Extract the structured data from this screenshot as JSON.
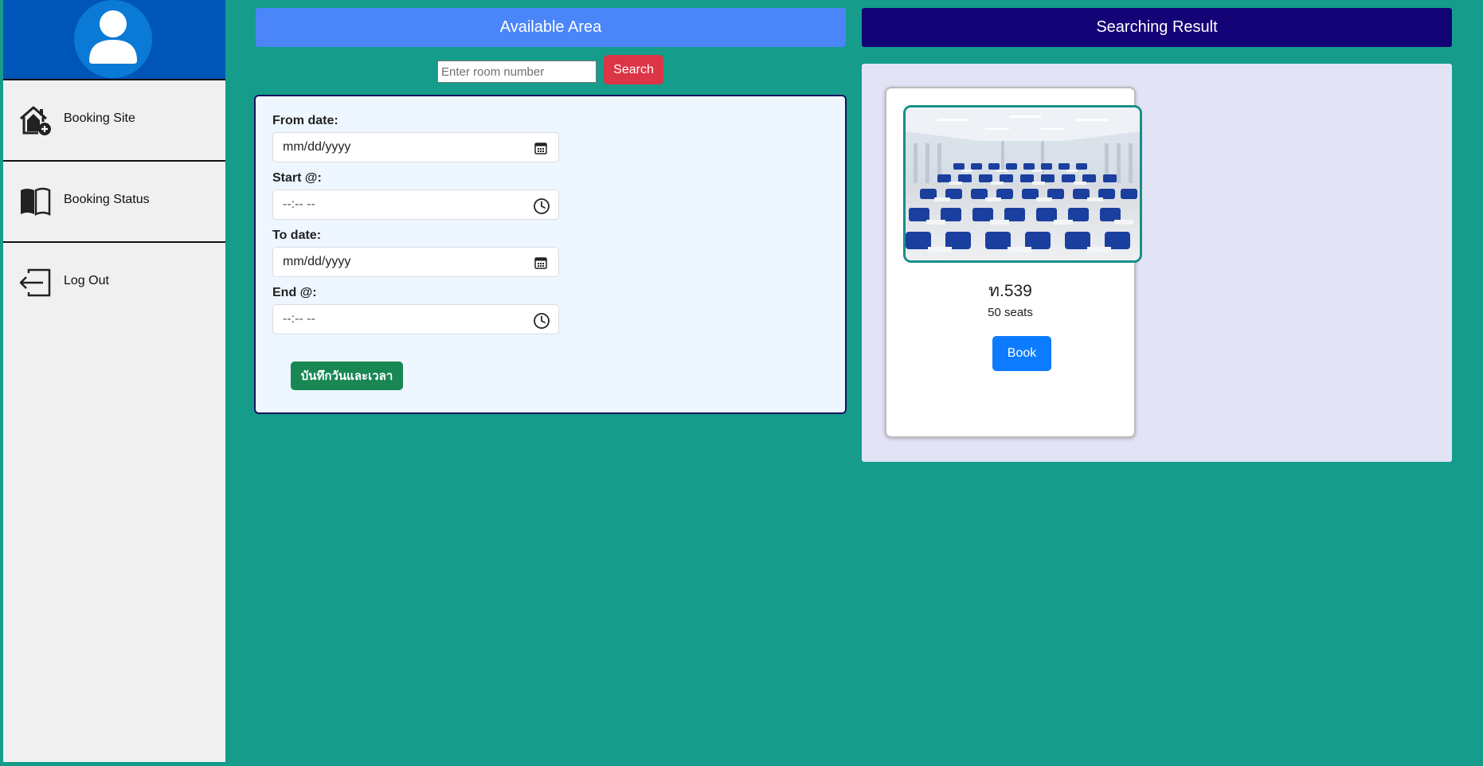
{
  "sidebar": {
    "items": [
      {
        "label": "Booking Site",
        "icon": "house-add-icon"
      },
      {
        "label": "Booking Status",
        "icon": "book-icon"
      },
      {
        "label": "Log Out",
        "icon": "logout-icon"
      }
    ]
  },
  "available": {
    "title": "Available Area",
    "search_placeholder": "Enter room number",
    "search_label": "Search",
    "form": {
      "from_date_label": "From date:",
      "from_date_value": "mm/dd/yyyy",
      "start_label": "Start @:",
      "start_value": "--:-- --",
      "to_date_label": "To date:",
      "to_date_value": "mm/dd/yyyy",
      "end_label": "End @:",
      "end_value": "--:-- --",
      "save_label": "บันทึกวันและเวลา"
    }
  },
  "results": {
    "title": "Searching Result",
    "rooms": [
      {
        "name": "ท.539",
        "seats": "50 seats",
        "book_label": "Book"
      }
    ]
  },
  "colors": {
    "background": "#159c8b",
    "sidebar_header": "#0055b8",
    "available_header": "#4a86fa",
    "result_header": "#140277",
    "search_button": "#dc3545",
    "save_button": "#198754",
    "book_button": "#0d7bfe"
  }
}
